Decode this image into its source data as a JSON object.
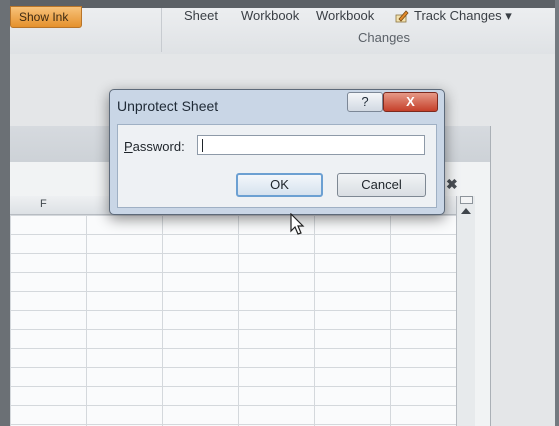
{
  "ribbon": {
    "show_ink_label": "Show Ink",
    "sheet_label": "Sheet",
    "workbook_label_1": "Workbook",
    "workbook_label_2": "Workbook",
    "track_changes_label": "Track Changes ▾",
    "group_label": "Changes"
  },
  "sheet": {
    "column_header": "F",
    "window_close_glyph": "✖"
  },
  "dialog": {
    "title": "Unprotect Sheet",
    "help_glyph": "?",
    "close_glyph": "X",
    "password_label_underlined": "P",
    "password_label_rest": "assword:",
    "password_value": "",
    "ok_label": "OK",
    "cancel_label": "Cancel"
  },
  "colors": {
    "dialog_frame": "#c9d6e6",
    "close_button": "#c5402a",
    "default_button_border": "#6ca0d2",
    "show_ink": "#e5912d"
  },
  "icons": [
    "pencil-icon",
    "help-icon",
    "close-icon",
    "scroll-up-arrow-icon",
    "mouse-pointer-icon"
  ]
}
